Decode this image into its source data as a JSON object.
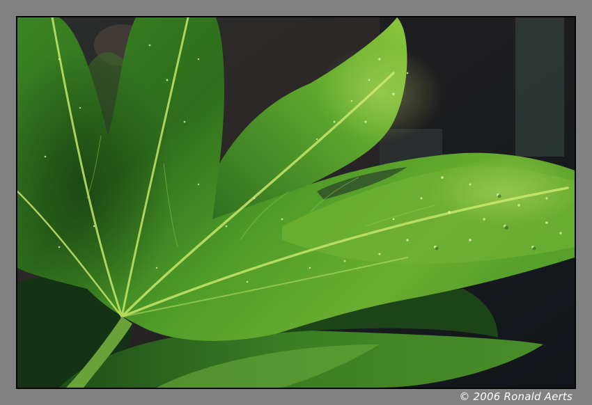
{
  "photo": {
    "subject_icon": "leaf-photo-icon"
  },
  "caption": {
    "copyright": "© 2006 Ronald Aerts"
  },
  "colors": {
    "frame": "#818181",
    "leaf_light": "#8bc43a",
    "leaf_mid": "#3f8a22",
    "leaf_dark": "#163d14",
    "background_dark": "#12161a"
  }
}
